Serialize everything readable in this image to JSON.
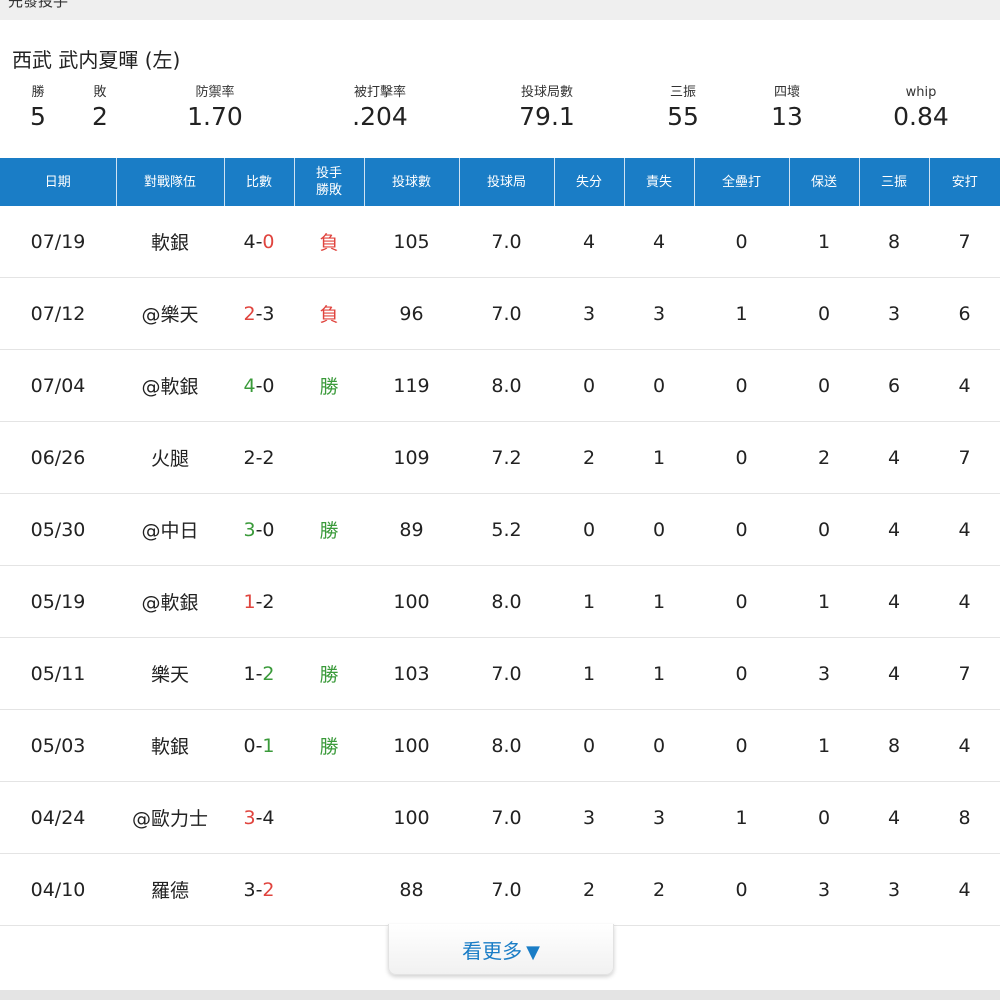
{
  "section": {
    "title": "先發投手"
  },
  "pitcher": {
    "name": "西武 武内夏暉 (左)"
  },
  "stats": [
    {
      "label": "勝",
      "value": "5"
    },
    {
      "label": "敗",
      "value": "2"
    },
    {
      "label": "防禦率",
      "value": "1.70"
    },
    {
      "label": "被打擊率",
      "value": ".204"
    },
    {
      "label": "投球局數",
      "value": "79.1"
    },
    {
      "label": "三振",
      "value": "55"
    },
    {
      "label": "四壞",
      "value": "13"
    },
    {
      "label": "whip",
      "value": "0.84"
    }
  ],
  "table": {
    "headers": {
      "date": "日期",
      "opponent": "對戰隊伍",
      "score": "比數",
      "decision_line1": "投手",
      "decision_line2": "勝敗",
      "pitches": "投球數",
      "innings": "投球局",
      "runs": "失分",
      "earned_runs": "責失",
      "home_runs": "全壘打",
      "walks": "保送",
      "strikeouts": "三振",
      "hits": "安打"
    },
    "rows": [
      {
        "date": "07/19",
        "opponent": "軟銀",
        "score_left": "4",
        "score_sep": "-",
        "score_right": "0",
        "highlight": "right",
        "highlight_color": "loss",
        "decision": "負",
        "pitches": "105",
        "innings": "7.0",
        "runs": "4",
        "earned_runs": "4",
        "home_runs": "0",
        "walks": "1",
        "strikeouts": "8",
        "hits": "7"
      },
      {
        "date": "07/12",
        "opponent": "@樂天",
        "score_left": "2",
        "score_sep": "-",
        "score_right": "3",
        "highlight": "left",
        "highlight_color": "loss",
        "decision": "負",
        "pitches": "96",
        "innings": "7.0",
        "runs": "3",
        "earned_runs": "3",
        "home_runs": "1",
        "walks": "0",
        "strikeouts": "3",
        "hits": "6"
      },
      {
        "date": "07/04",
        "opponent": "@軟銀",
        "score_left": "4",
        "score_sep": "-",
        "score_right": "0",
        "highlight": "left",
        "highlight_color": "win",
        "decision": "勝",
        "pitches": "119",
        "innings": "8.0",
        "runs": "0",
        "earned_runs": "0",
        "home_runs": "0",
        "walks": "0",
        "strikeouts": "6",
        "hits": "4"
      },
      {
        "date": "06/26",
        "opponent": "火腿",
        "score_left": "2",
        "score_sep": "-",
        "score_right": "2",
        "highlight": "none",
        "highlight_color": "none",
        "decision": "",
        "pitches": "109",
        "innings": "7.2",
        "runs": "2",
        "earned_runs": "1",
        "home_runs": "0",
        "walks": "2",
        "strikeouts": "4",
        "hits": "7"
      },
      {
        "date": "05/30",
        "opponent": "@中日",
        "score_left": "3",
        "score_sep": "-",
        "score_right": "0",
        "highlight": "left",
        "highlight_color": "win",
        "decision": "勝",
        "pitches": "89",
        "innings": "5.2",
        "runs": "0",
        "earned_runs": "0",
        "home_runs": "0",
        "walks": "0",
        "strikeouts": "4",
        "hits": "4"
      },
      {
        "date": "05/19",
        "opponent": "@軟銀",
        "score_left": "1",
        "score_sep": "-",
        "score_right": "2",
        "highlight": "left",
        "highlight_color": "loss",
        "decision": "",
        "pitches": "100",
        "innings": "8.0",
        "runs": "1",
        "earned_runs": "1",
        "home_runs": "0",
        "walks": "1",
        "strikeouts": "4",
        "hits": "4"
      },
      {
        "date": "05/11",
        "opponent": "樂天",
        "score_left": "1",
        "score_sep": "-",
        "score_right": "2",
        "highlight": "right",
        "highlight_color": "win",
        "decision": "勝",
        "pitches": "103",
        "innings": "7.0",
        "runs": "1",
        "earned_runs": "1",
        "home_runs": "0",
        "walks": "3",
        "strikeouts": "4",
        "hits": "7"
      },
      {
        "date": "05/03",
        "opponent": "軟銀",
        "score_left": "0",
        "score_sep": "-",
        "score_right": "1",
        "highlight": "right",
        "highlight_color": "win",
        "decision": "勝",
        "pitches": "100",
        "innings": "8.0",
        "runs": "0",
        "earned_runs": "0",
        "home_runs": "0",
        "walks": "1",
        "strikeouts": "8",
        "hits": "4"
      },
      {
        "date": "04/24",
        "opponent": "@歐力士",
        "score_left": "3",
        "score_sep": "-",
        "score_right": "4",
        "highlight": "left",
        "highlight_color": "loss",
        "decision": "",
        "pitches": "100",
        "innings": "7.0",
        "runs": "3",
        "earned_runs": "3",
        "home_runs": "1",
        "walks": "0",
        "strikeouts": "4",
        "hits": "8"
      },
      {
        "date": "04/10",
        "opponent": "羅德",
        "score_left": "3",
        "score_sep": "-",
        "score_right": "2",
        "highlight": "right",
        "highlight_color": "loss",
        "decision": "",
        "pitches": "88",
        "innings": "7.0",
        "runs": "2",
        "earned_runs": "2",
        "home_runs": "0",
        "walks": "3",
        "strikeouts": "3",
        "hits": "4"
      }
    ]
  },
  "more_button": {
    "label": "看更多",
    "icon": "triangle-down-icon",
    "arrow": "▼"
  },
  "colors": {
    "header_bg": "#1a7dc6",
    "win": "#3a9a3a",
    "loss": "#e0443e",
    "link": "#1a7dc6"
  }
}
